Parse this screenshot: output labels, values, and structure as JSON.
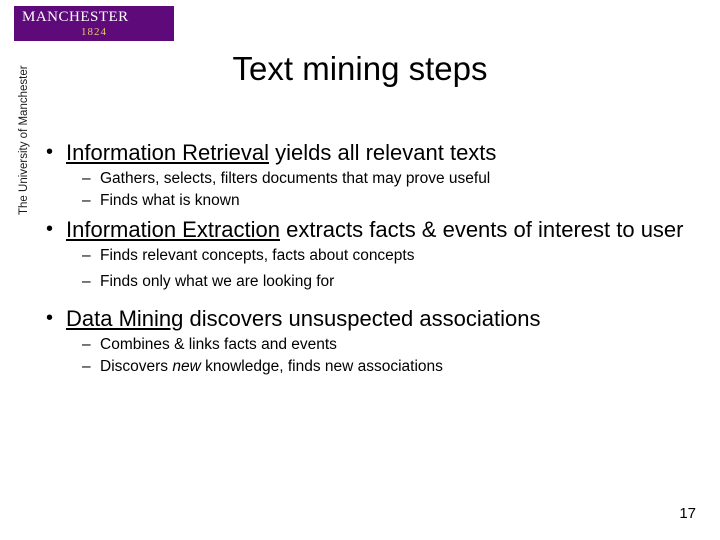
{
  "logo": {
    "name": "MANCHESTER",
    "year": "1824",
    "side": "The University of Manchester"
  },
  "title": "Text mining steps",
  "bullets": {
    "b1a": {
      "lead": "Information Retrieval",
      "rest": " yields all relevant texts"
    },
    "b1a_s1": "Gathers, selects, filters documents that may prove useful",
    "b1a_s2": "Finds what is known",
    "b1b": {
      "lead": "Information Extraction",
      "rest": " extracts facts & events of interest to user"
    },
    "b1b_s1": "Finds relevant concepts, facts about concepts",
    "b1b_s2": "Finds only what we are looking for",
    "b1c": {
      "lead": "Data Mining",
      "rest": " discovers unsuspected associations"
    },
    "b1c_s1": "Combines & links facts and events",
    "b1c_s2a": "Discovers ",
    "b1c_s2b": "new",
    "b1c_s2c": " knowledge, finds new associations"
  },
  "page": "17"
}
